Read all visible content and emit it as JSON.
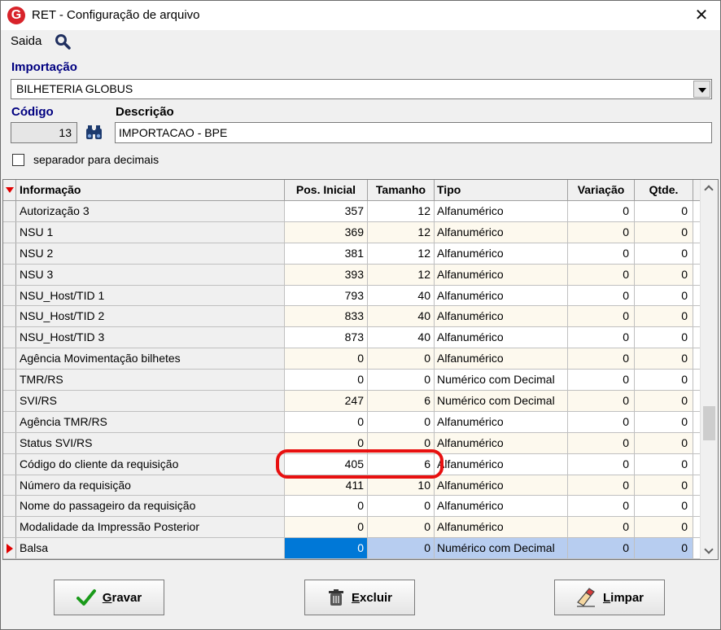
{
  "window": {
    "title": "RET - Configuração de arquivo",
    "app_icon": "G",
    "close_glyph": "✕"
  },
  "menu": {
    "saida": "Saida"
  },
  "importacao": {
    "label": "Importação",
    "value": "BILHETERIA GLOBUS"
  },
  "codigo": {
    "label": "Código",
    "value": "13"
  },
  "descricao": {
    "label": "Descrição",
    "value": "IMPORTACAO - BPE"
  },
  "separador": {
    "label": "separador para decimais",
    "checked": false
  },
  "grid": {
    "headers": {
      "info": "Informação",
      "pos": "Pos. Inicial",
      "tam": "Tamanho",
      "tipo": "Tipo",
      "var": "Variação",
      "qtd": "Qtde."
    },
    "rows": [
      {
        "info": "Autorização 3",
        "pos": "357",
        "tam": "12",
        "tipo": "Alfanumérico",
        "var": "0",
        "qtd": "0"
      },
      {
        "info": "NSU 1",
        "pos": "369",
        "tam": "12",
        "tipo": "Alfanumérico",
        "var": "0",
        "qtd": "0"
      },
      {
        "info": "NSU 2",
        "pos": "381",
        "tam": "12",
        "tipo": "Alfanumérico",
        "var": "0",
        "qtd": "0"
      },
      {
        "info": "NSU 3",
        "pos": "393",
        "tam": "12",
        "tipo": "Alfanumérico",
        "var": "0",
        "qtd": "0"
      },
      {
        "info": "NSU_Host/TID 1",
        "pos": "793",
        "tam": "40",
        "tipo": "Alfanumérico",
        "var": "0",
        "qtd": "0"
      },
      {
        "info": "NSU_Host/TID 2",
        "pos": "833",
        "tam": "40",
        "tipo": "Alfanumérico",
        "var": "0",
        "qtd": "0"
      },
      {
        "info": "NSU_Host/TID 3",
        "pos": "873",
        "tam": "40",
        "tipo": "Alfanumérico",
        "var": "0",
        "qtd": "0"
      },
      {
        "info": "Agência Movimentação bilhetes",
        "pos": "0",
        "tam": "0",
        "tipo": "Alfanumérico",
        "var": "0",
        "qtd": "0"
      },
      {
        "info": "TMR/RS",
        "pos": "0",
        "tam": "0",
        "tipo": "Numérico com Decimal",
        "var": "0",
        "qtd": "0"
      },
      {
        "info": "SVI/RS",
        "pos": "247",
        "tam": "6",
        "tipo": "Numérico com Decimal",
        "var": "0",
        "qtd": "0"
      },
      {
        "info": "Agência TMR/RS",
        "pos": "0",
        "tam": "0",
        "tipo": "Alfanumérico",
        "var": "0",
        "qtd": "0"
      },
      {
        "info": "Status SVI/RS",
        "pos": "0",
        "tam": "0",
        "tipo": "Alfanumérico",
        "var": "0",
        "qtd": "0"
      },
      {
        "info": "Código do cliente da requisição",
        "pos": "405",
        "tam": "6",
        "tipo": "Alfanumérico",
        "var": "0",
        "qtd": "0"
      },
      {
        "info": "Número da requisição",
        "pos": "411",
        "tam": "10",
        "tipo": "Alfanumérico",
        "var": "0",
        "qtd": "0"
      },
      {
        "info": "Nome do passageiro da requisição",
        "pos": "0",
        "tam": "0",
        "tipo": "Alfanumérico",
        "var": "0",
        "qtd": "0"
      },
      {
        "info": "Modalidade da Impressão Posterior",
        "pos": "0",
        "tam": "0",
        "tipo": "Alfanumérico",
        "var": "0",
        "qtd": "0"
      },
      {
        "info": "Balsa",
        "pos": "0",
        "tam": "0",
        "tipo": "Numérico com Decimal",
        "var": "0",
        "qtd": "0"
      }
    ],
    "selected_index": 16
  },
  "buttons": {
    "gravar": {
      "mnemonic": "G",
      "rest": "ravar"
    },
    "excluir": {
      "mnemonic": "E",
      "rest": "xcluir"
    },
    "limpar": {
      "mnemonic": "L",
      "rest": "impar"
    }
  },
  "colors": {
    "accent": "#000080",
    "selection": "#0078d7",
    "indicator": "#e00000",
    "highlight_ring": "#e81010"
  },
  "icons": [
    "search-icon",
    "binoculars-icon",
    "checkmark-icon",
    "trash-icon",
    "eraser-icon",
    "sort-indicator-icon",
    "current-row-icon",
    "close-icon"
  ]
}
